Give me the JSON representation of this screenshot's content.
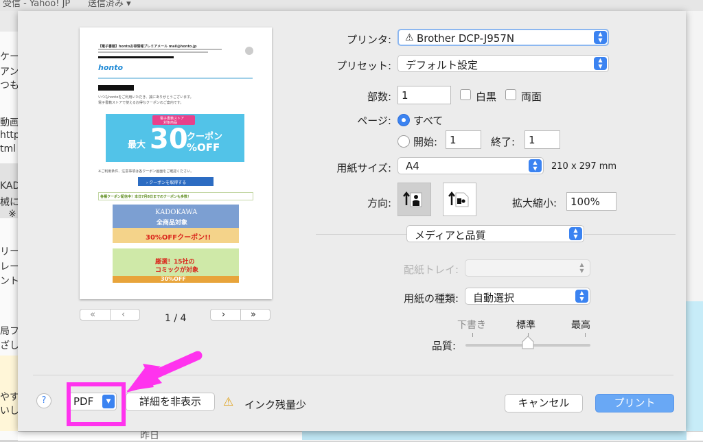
{
  "background": {
    "topbar_left": "受信 - Yahoo! JP",
    "topbar_right": "送信済み ▾",
    "left_fragments": [
      "ケー",
      "アン",
      "つもス",
      "動画",
      "http",
      "tml -",
      "KAD",
      "械に",
      "※",
      "リー",
      "レー",
      "ント",
      "局フ",
      "ざし",
      "やすね",
      "いし"
    ],
    "bottom_fragment": "昨日"
  },
  "preview": {
    "page_indicator": "1 / 4",
    "first_label": "«",
    "prev_label": "‹",
    "next_label": "›",
    "last_label": "»",
    "email": {
      "subject": "【電子書籍】hontoお得情報プレミアメール  mail@honto.jp",
      "logo": "honto",
      "greeting": "いつもhontoをご利用いただき、誠にありがとうございます。",
      "greeting2": "電子書籍ストアで使えるお得なクーポンのご案内です。",
      "coupon_badge_line1": "電子書籍ストア",
      "coupon_badge_line2": "対象商品",
      "coupon_max": "最大",
      "coupon_pct": "30",
      "coupon_word": "クーポン",
      "coupon_off": "%OFF",
      "note": "※ご利用条件、注意事項は各クーポン画面をご確認ください。",
      "cta": "› クーポンを取得する",
      "banner_caption": "各種クーポン配信中！本日7月8日までのクーポンも多数！",
      "kadokawa_title": "KADOKAWA",
      "kadokawa_sub": "全商品対象",
      "kadokawa_off": "30%OFFクーポン!!",
      "comic_title": "厳選！15社の",
      "comic_sub": "コミックが対象",
      "comic_off": "30%OFF"
    }
  },
  "form": {
    "printer_label": "プリンタ:",
    "printer_value": "Brother DCP-J957N",
    "printer_icon": "warning-icon",
    "preset_label": "プリセット:",
    "preset_value": "デフォルト設定",
    "copies_label": "部数:",
    "copies_value": "1",
    "bw_label": "白黒",
    "duplex_label": "両面",
    "pages_label": "ページ:",
    "pages_all": "すべて",
    "pages_from": "開始:",
    "pages_from_value": "1",
    "pages_to": "終了:",
    "pages_to_value": "1",
    "paper_size_label": "用紙サイズ:",
    "paper_size_value": "A4",
    "paper_size_dims": "210 x 297 mm",
    "orientation_label": "方向:",
    "scale_label": "拡大縮小:",
    "scale_value": "100%",
    "section_value": "メディアと品質",
    "tray_label": "配紙トレイ:",
    "tray_value": "",
    "media_type_label": "用紙の種類:",
    "media_type_value": "自動選択",
    "quality_label": "品質:",
    "quality_options": [
      "下書き",
      "標準",
      "最高"
    ],
    "quality_selected": "標準",
    "quality_level": 0.5
  },
  "footer": {
    "help_label": "?",
    "pdf_label": "PDF",
    "details_label": "詳細を非表示",
    "ink_warning": "インク残量少",
    "cancel_label": "キャンセル",
    "print_label": "プリント"
  },
  "colors": {
    "accent": "#3b83f1",
    "annotation": "#ff33ee",
    "primary_button": "#69a8f5"
  }
}
